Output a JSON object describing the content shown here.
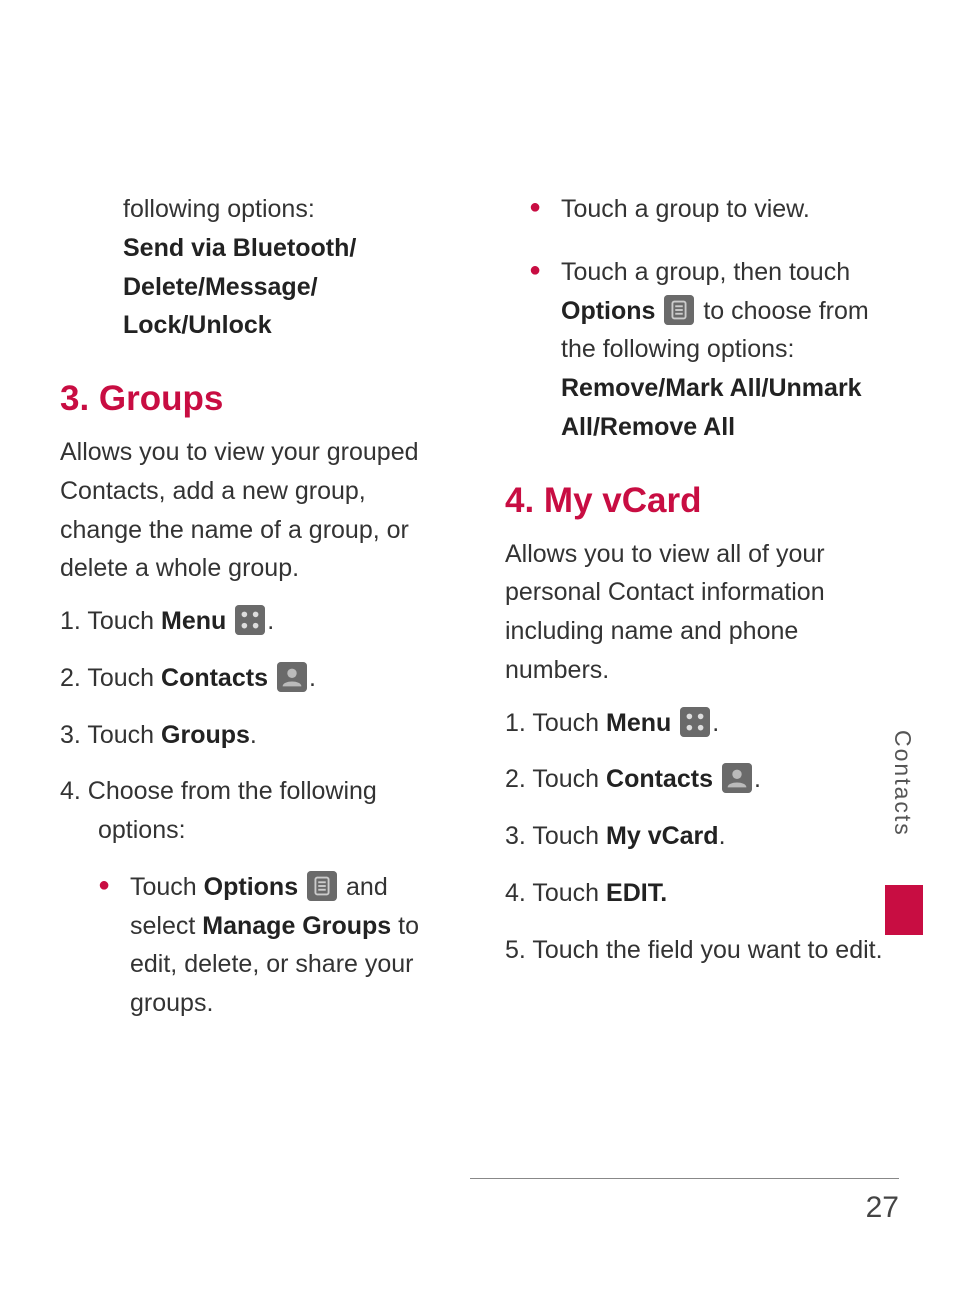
{
  "side_tab": "Contacts",
  "page_number": "27",
  "col1": {
    "intro_line1": "following options:",
    "intro_line2": "Send via Bluetooth/ Delete/Message/ Lock/Unlock",
    "h_groups": "3. Groups",
    "groups_desc": "Allows you to view your grouped Contacts, add a new group, change the name of a group, or delete a whole group.",
    "step1_pre": "1. Touch ",
    "step1_bold": "Menu",
    "step1_post": ".",
    "step2_pre": "2. Touch ",
    "step2_bold": "Contacts",
    "step2_post": ".",
    "step3_pre": "3. Touch ",
    "step3_bold": "Groups",
    "step3_post": ".",
    "step4": "4. Choose from the following options:",
    "b1_pre": "Touch ",
    "b1_bold1": "Options",
    "b1_mid": " and select ",
    "b1_bold2": "Manage Groups",
    "b1_post": " to edit, delete, or share your groups."
  },
  "col2": {
    "b1": "Touch a group to view.",
    "b2_pre": "Touch a group, then touch ",
    "b2_bold1": "Options",
    "b2_mid": " to choose from the following options: ",
    "b2_bold2": "Remove/Mark All/Unmark All/Remove All",
    "h_vcard": "4. My vCard",
    "vcard_desc": "Allows you to view all of your personal Contact information including name and phone numbers.",
    "step1_pre": "1. Touch ",
    "step1_bold": "Menu",
    "step1_post": ".",
    "step2_pre": "2. Touch ",
    "step2_bold": "Contacts",
    "step2_post": ".",
    "step3_pre": "3. Touch ",
    "step3_bold": "My vCard",
    "step3_post": ".",
    "step4_pre": "4. Touch ",
    "step4_bold": "EDIT.",
    "step5": "5. Touch the field you want to edit."
  }
}
